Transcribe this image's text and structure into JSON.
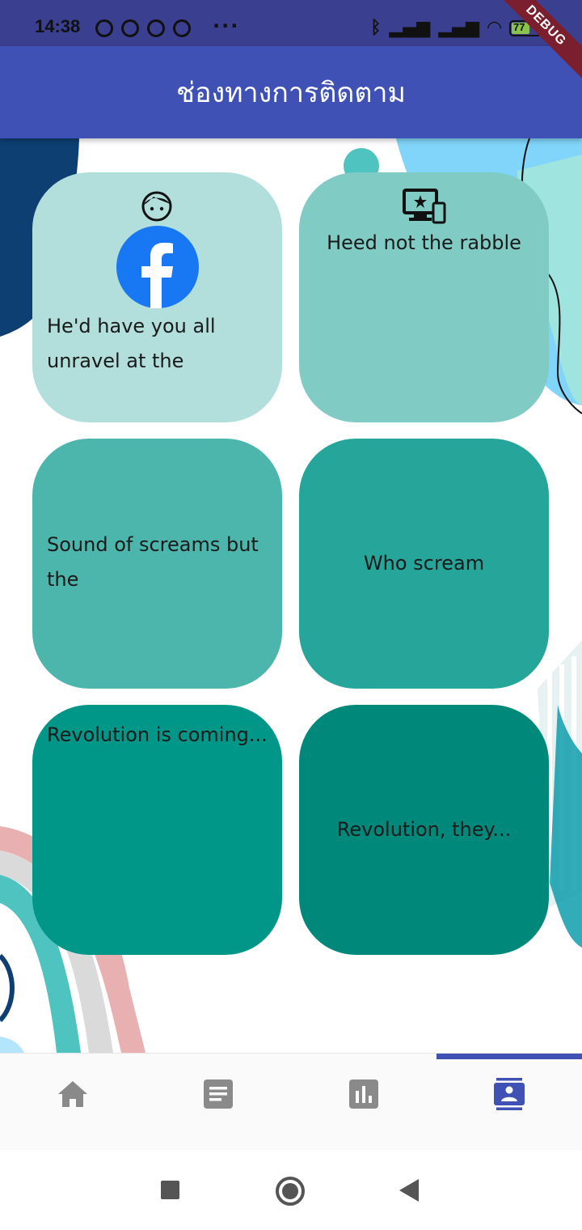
{
  "status_bar": {
    "time": "14:38",
    "more": "···",
    "battery": "77",
    "debug_banner": "DEBUG"
  },
  "app_bar": {
    "title": "ช่องทางการติดตาม"
  },
  "cards": [
    {
      "text": "He'd have you all unravel at the",
      "icons": [
        "face-icon",
        "facebook-icon"
      ],
      "color": "#b2dfdb"
    },
    {
      "text": "Heed not the rabble",
      "icons": [
        "devices-icon"
      ],
      "color": "#80cbc4"
    },
    {
      "text": "Sound of screams but the",
      "icons": [],
      "color": "#4db6ac"
    },
    {
      "text": "Who scream",
      "icons": [],
      "color": "#26a69a"
    },
    {
      "text": "Revolution is coming...",
      "icons": [],
      "color": "#009688"
    },
    {
      "text": "Revolution, they...",
      "icons": [],
      "color": "#00897b"
    }
  ],
  "bottom_nav": {
    "items": [
      "home-icon",
      "article-icon",
      "bar-chart-icon",
      "contacts-icon"
    ],
    "selected": 3,
    "accent": "#3f51b5"
  },
  "colors": {
    "app_bar": "#3f51b5",
    "status_bar": "#3a3f8f"
  }
}
